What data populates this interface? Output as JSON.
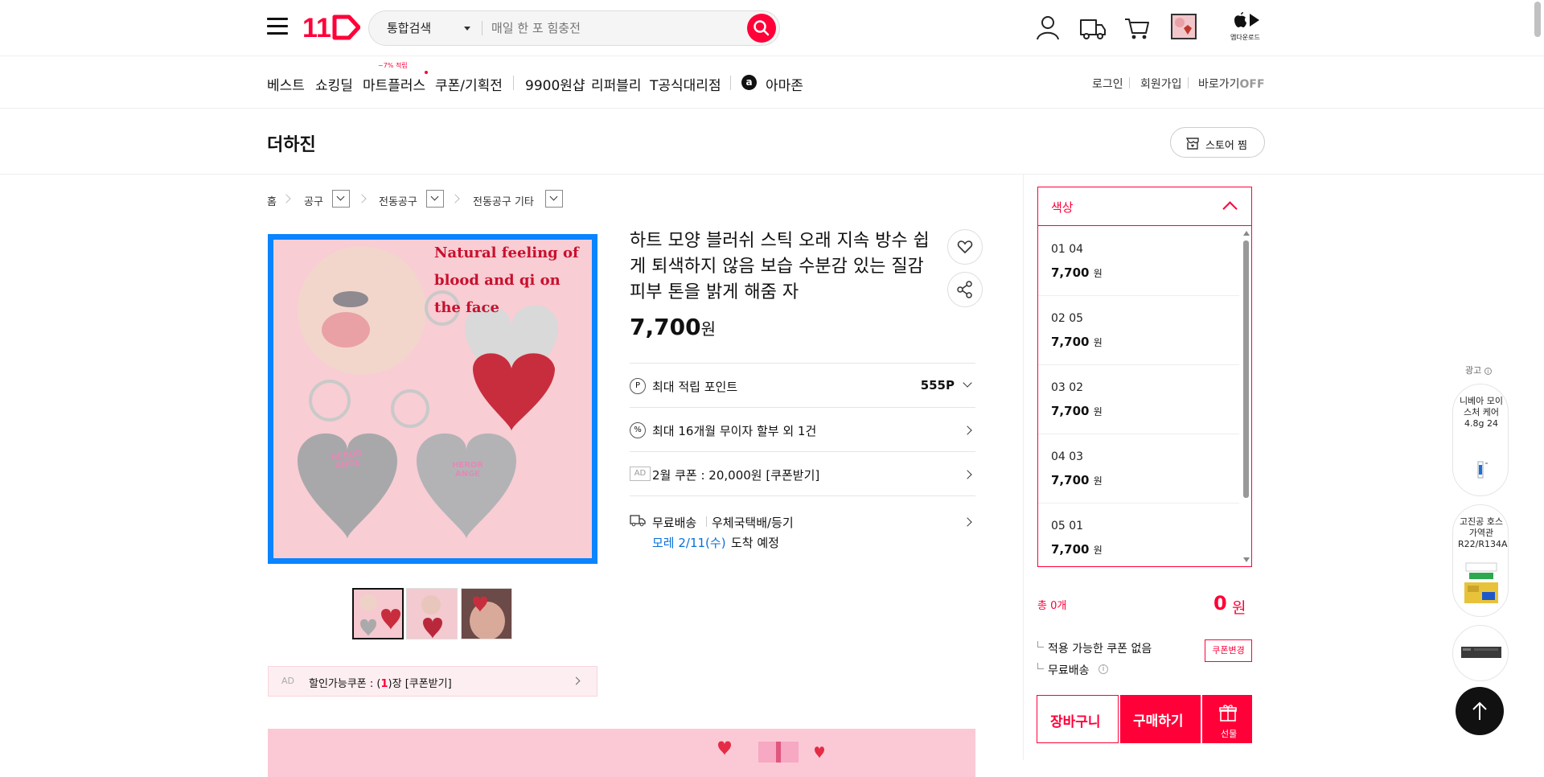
{
  "header": {
    "logo": "11",
    "search_scope": "통합검색",
    "search_placeholder": "매일 한 포 힘충전",
    "app_download": "앱다운로드"
  },
  "gnb": {
    "items": [
      "베스트",
      "쇼킹딜",
      "마트플러스",
      "쿠폰/기획전",
      "9900원샵",
      "리퍼블리",
      "T공식대리점",
      "아마존"
    ],
    "mart_badge": "~7% 적립",
    "utils": [
      "로그인",
      "회원가입",
      "바로가기"
    ],
    "shortcut_state": "OFF"
  },
  "store": {
    "name": "더하진",
    "bookmark_label": "스토어 찜"
  },
  "breadcrumb": [
    "홈",
    "공구",
    "전동공구",
    "전동공구 기타"
  ],
  "main_image": {
    "caption_lines": [
      "Natural feeling of",
      "blood and qi on",
      "the face"
    ],
    "engraving": [
      "HEROR",
      "ANGE"
    ]
  },
  "product": {
    "title": "하트 모양 블러쉬 스틱 오래 지속 방수 쉽게 퇴색하지 않음 보습 수분감 있는 질감 피부 톤을 밝게 해줌 자",
    "price": "7,700",
    "currency": "원",
    "points_icon": "P",
    "points_label": "최대 적립 포인트",
    "points_value": "555P",
    "installment_icon": "%",
    "installment_label": "최대 16개월 무이자 할부 외 1건",
    "ad_badge": "AD",
    "coupon_label": "2월 쿠폰 : 20,000원 [쿠폰받기]",
    "shipping_free": "무료배송",
    "shipping_method": "우체국택배/등기",
    "arrival_date": "모레 2/11(수)",
    "arrival_suffix": "도착 예정",
    "discount_coupon_prefix": "할인가능쿠폰 : (",
    "discount_coupon_count": "1",
    "discount_coupon_suffix": ")장 [쿠폰받기]"
  },
  "options": {
    "header": "색상",
    "items": [
      {
        "name": "01 04",
        "price": "7,700",
        "won": "원"
      },
      {
        "name": "02 05",
        "price": "7,700",
        "won": "원"
      },
      {
        "name": "03 02",
        "price": "7,700",
        "won": "원"
      },
      {
        "name": "04 03",
        "price": "7,700",
        "won": "원"
      },
      {
        "name": "05 01",
        "price": "7,700",
        "won": "원"
      }
    ]
  },
  "order": {
    "total_count": "총 0개",
    "total_price": "0",
    "total_won": "원",
    "coupon_none": "적용 가능한 쿠폰 없음",
    "coupon_change": "쿠폰변경",
    "free_shipping": "무료배송",
    "cart_label": "장바구니",
    "buy_label": "구매하기",
    "gift_label": "선물"
  },
  "ads": {
    "label": "광고",
    "cards": [
      {
        "text": "니베아 모이스처 케어 4.8g 24"
      },
      {
        "text": "고진공 호스 가역관 R22/R134A"
      },
      {
        "text": ""
      }
    ]
  },
  "colors": {
    "accent": "#ff0038",
    "highlight": "#0a84ff",
    "link_blue": "#0a6fd6"
  }
}
